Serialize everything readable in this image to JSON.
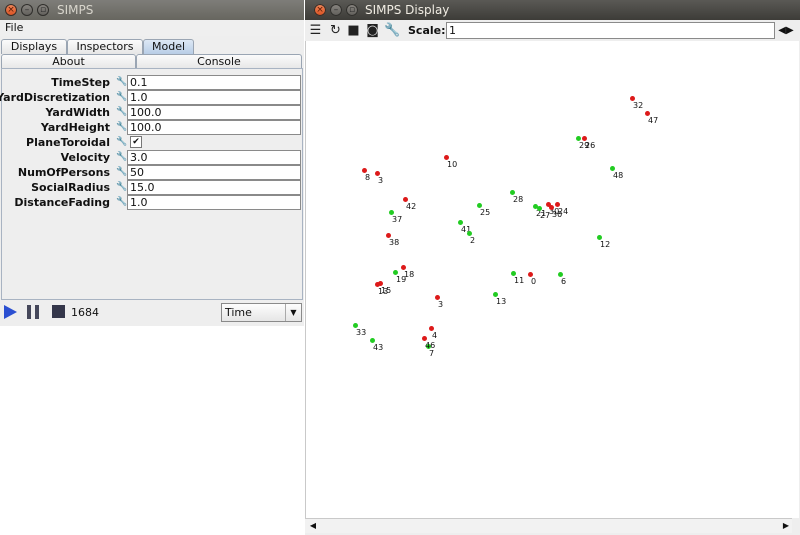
{
  "left_window": {
    "title": "SIMPS",
    "menu": {
      "file": "File"
    },
    "tabs_top": [
      "Displays",
      "Inspectors",
      "Model"
    ],
    "tabs_bottom": [
      "About",
      "Console"
    ],
    "properties": [
      {
        "label": "TimeStep",
        "value": "0.1"
      },
      {
        "label": "YardDiscretization",
        "value": "1.0"
      },
      {
        "label": "YardWidth",
        "value": "100.0"
      },
      {
        "label": "YardHeight",
        "value": "100.0"
      },
      {
        "label": "PlaneToroidal",
        "value": "✔"
      },
      {
        "label": "Velocity",
        "value": "3.0"
      },
      {
        "label": "NumOfPersons",
        "value": "50"
      },
      {
        "label": "SocialRadius",
        "value": "15.0"
      },
      {
        "label": "DistanceFading",
        "value": "1.0"
      }
    ],
    "controls": {
      "step_count": "1684",
      "time_mode": "Time"
    }
  },
  "right_window": {
    "title": "SIMPS Display",
    "toolbar": {
      "scale_label": "Scale:",
      "scale_value": "1"
    }
  },
  "colors": {
    "agent_red": "#dd1a1a",
    "agent_green": "#22cc22",
    "accent_blue": "#2b4fd1"
  },
  "agents": [
    {
      "label": "0",
      "color": "red"
    },
    {
      "label": "3",
      "color": "red"
    },
    {
      "label": "4",
      "color": "red"
    },
    {
      "label": "6",
      "color": "green"
    },
    {
      "label": "7",
      "color": "green"
    },
    {
      "label": "8",
      "color": "red"
    },
    {
      "label": "10",
      "color": "red"
    },
    {
      "label": "11",
      "color": "green"
    },
    {
      "label": "12",
      "color": "green"
    },
    {
      "label": "13",
      "color": "green"
    },
    {
      "label": "15",
      "color": "red"
    },
    {
      "label": "18",
      "color": "red"
    },
    {
      "label": "19",
      "color": "green"
    },
    {
      "label": "21",
      "color": "green"
    },
    {
      "label": "24",
      "color": "red"
    },
    {
      "label": "25",
      "color": "green"
    },
    {
      "label": "26",
      "color": "red"
    },
    {
      "label": "27",
      "color": "green"
    },
    {
      "label": "28",
      "color": "green"
    },
    {
      "label": "29",
      "color": "green"
    },
    {
      "label": "30",
      "color": "red"
    },
    {
      "label": "32",
      "color": "red"
    },
    {
      "label": "33",
      "color": "green"
    },
    {
      "label": "37",
      "color": "green"
    },
    {
      "label": "38",
      "color": "red"
    },
    {
      "label": "41",
      "color": "green"
    },
    {
      "label": "42",
      "color": "red"
    },
    {
      "label": "43",
      "color": "green"
    },
    {
      "label": "46",
      "color": "red"
    },
    {
      "label": "47",
      "color": "red"
    },
    {
      "label": "48",
      "color": "green"
    },
    {
      "label": "3",
      "color": "red"
    },
    {
      "label": "2",
      "color": "green"
    },
    {
      "label": "13",
      "color": "red"
    },
    {
      "label": "30",
      "color": "red"
    }
  ]
}
